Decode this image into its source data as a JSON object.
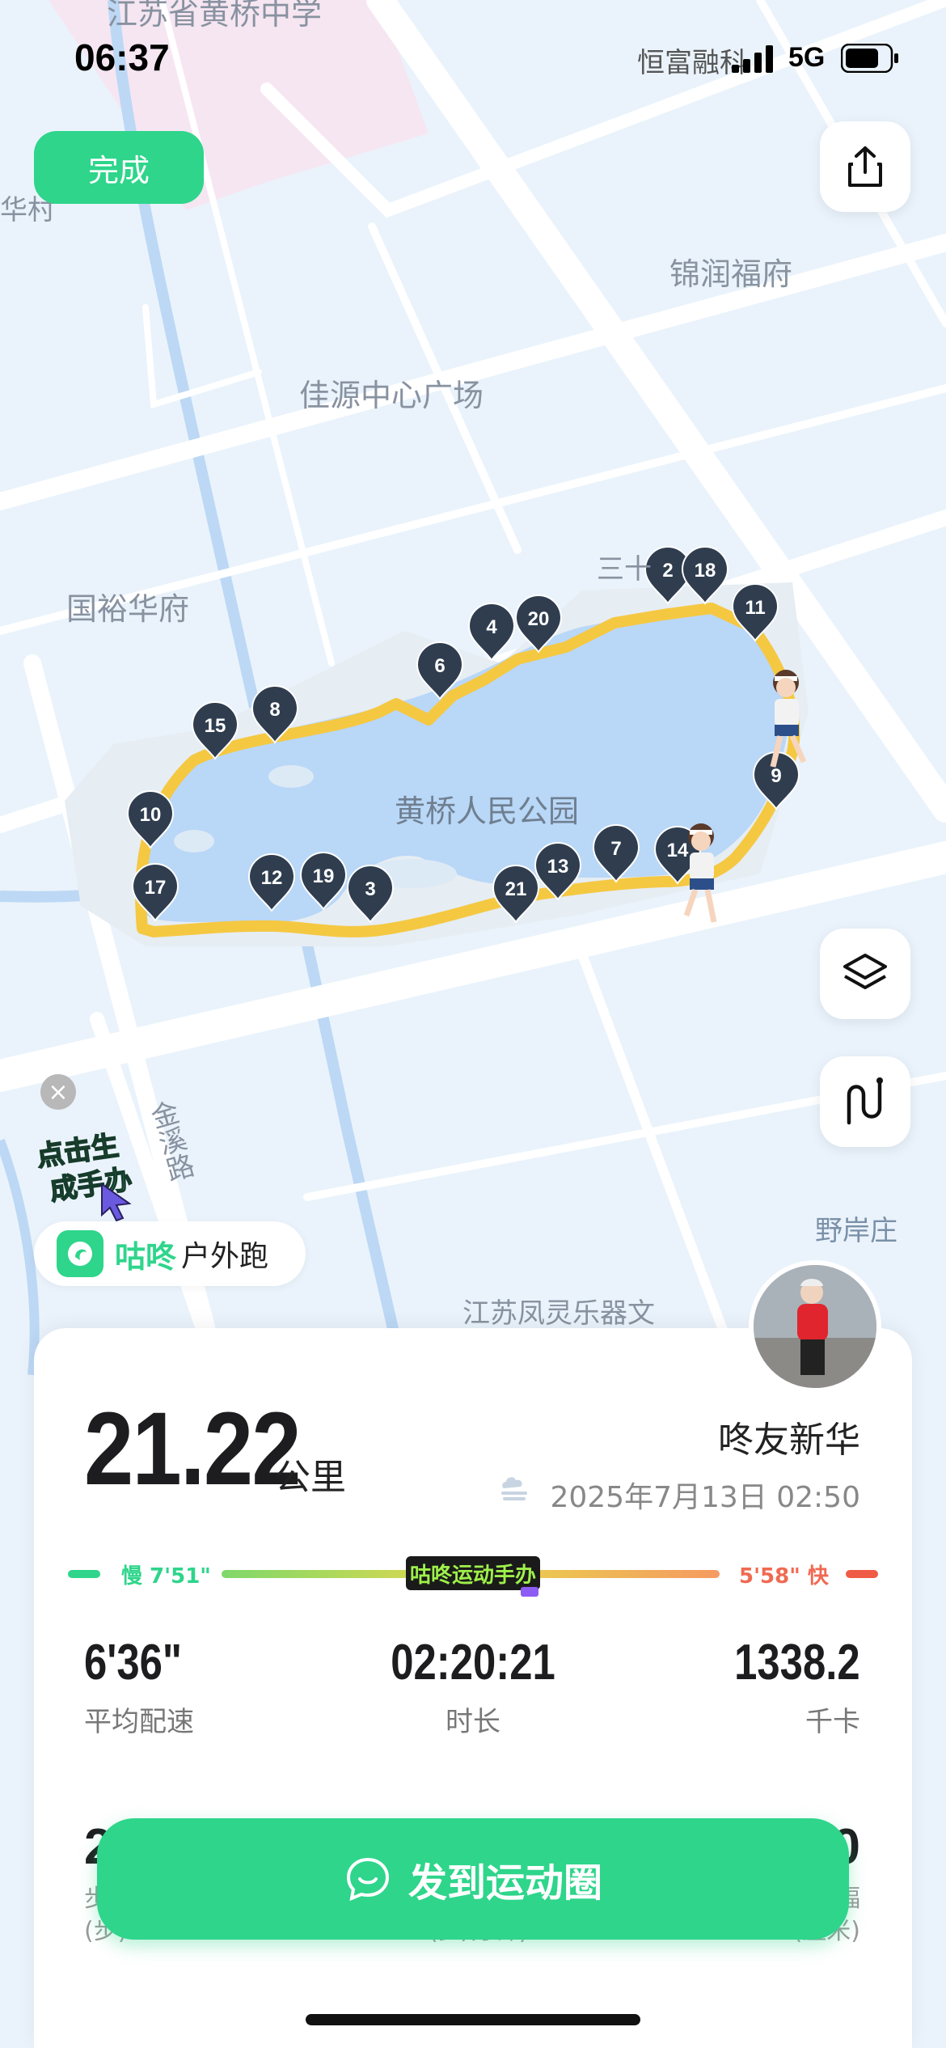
{
  "status_bar": {
    "time": "06:37",
    "carrier": "恒富融科",
    "network": "5G"
  },
  "map": {
    "labels": {
      "school": "江苏省黄桥中学",
      "village": "华村",
      "jinrun": "锦润福府",
      "jiayuan": "佳源中心广场",
      "guoyu": "国裕华府",
      "sanshi": "三十",
      "park": "黄桥人民公园",
      "road": "金溪路",
      "yean": "野岸庄",
      "fengling": "江苏凤灵乐器文"
    },
    "km_markers": [
      "2",
      "18",
      "11",
      "4",
      "20",
      "6",
      "8",
      "15",
      "9",
      "10",
      "17",
      "12",
      "19",
      "3",
      "21",
      "13",
      "7",
      "14"
    ],
    "route_color": "#f5c842"
  },
  "buttons": {
    "done": "完成",
    "share_icon": "share-icon",
    "layers_icon": "layers-icon",
    "route_icon": "route-icon",
    "share_to_moments": "发到运动圈"
  },
  "promo": {
    "sticker_line1": "点击生",
    "sticker_line2": "成手办",
    "brand": "咕咚",
    "tag": "户外跑"
  },
  "summary": {
    "distance": "21.22",
    "distance_unit": "公里",
    "user": "咚友新华",
    "datetime": "2025年7月13日 02:50",
    "pace_slow": "慢 7'51\"",
    "pace_fast": "5'58\" 快",
    "pace_logo": "咕咚运动手办",
    "stats": [
      {
        "value": "6'36\"",
        "label": "平均配速"
      },
      {
        "value": "02:20:21",
        "label": "时长"
      },
      {
        "value": "1338.2",
        "label": "千卡"
      }
    ],
    "row2_left_value": "2",
    "row2_left_label_1": "步",
    "row2_left_label_2": "(步)",
    "row2_mid_label": "(步/分钟)",
    "row2_right_value": "0",
    "row2_right_label_1": "幅",
    "row2_right_label_2": "(厘米)"
  },
  "colors": {
    "accent": "#2ed58b",
    "fast": "#ef5b45",
    "pin": "#2f3d4f"
  }
}
